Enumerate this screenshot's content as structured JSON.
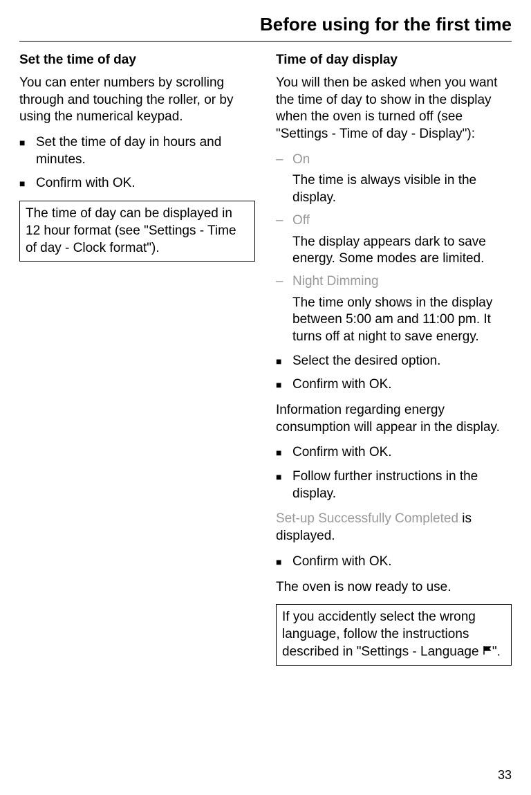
{
  "page_title": "Before using for the first time",
  "page_number": "33",
  "left": {
    "heading": "Set the time of day",
    "intro": "You can enter numbers by scrolling through and touching the roller, or by using the numerical keypad.",
    "steps": [
      "Set the time of day in hours and minutes.",
      "Confirm with OK."
    ],
    "note": "The time of day can be displayed in 12 hour format (see \"Settings - Time of day - Clock format\")."
  },
  "right": {
    "heading": "Time of day display",
    "intro": "You will then be asked when you want the time of day to show in the display when the oven is turned off (see \"Settings - Time of day - Display\"):",
    "options": [
      {
        "label": "On",
        "body": "The time is always visible in the display."
      },
      {
        "label": "Off",
        "body": "The display appears dark to save energy. Some modes are limited."
      },
      {
        "label": "Night Dimming",
        "body": "The time only shows in the display between 5:00 am and 11:00 pm. It turns off at night to save energy."
      }
    ],
    "steps1": [
      "Select the desired option.",
      "Confirm with OK."
    ],
    "info1": "Information regarding energy consumption will appear in the display.",
    "steps2": [
      "Confirm with OK.",
      "Follow further instructions in the display."
    ],
    "setup_msg_gray": "Set-up Successfully Completed",
    "setup_msg_rest": " is displayed.",
    "steps3": [
      "Confirm with OK."
    ],
    "ready": "The oven is now ready to use.",
    "note_pre": "If you accidently select the wrong language, follow the instructions described in \"Settings - Language ",
    "note_post": "\"."
  }
}
